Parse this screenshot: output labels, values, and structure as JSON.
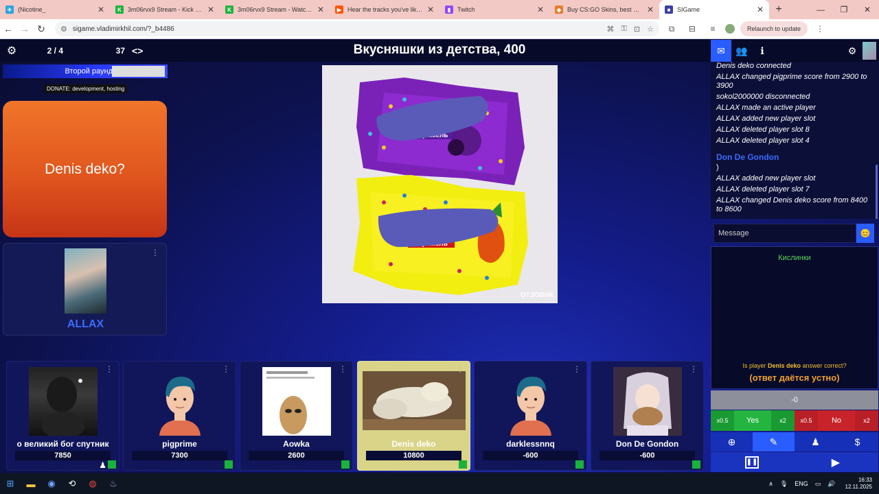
{
  "browser": {
    "tabs": [
      {
        "title": "(Nicotine_",
        "icon_color": "#2aa3e0",
        "icon_glyph": "✈"
      },
      {
        "title": "3m06rvx9 Stream - Kick Dashbo",
        "icon_color": "#1db33a",
        "icon_glyph": "K"
      },
      {
        "title": "3m06rvx9 Stream - Watch Live",
        "icon_color": "#1db33a",
        "icon_glyph": "K"
      },
      {
        "title": "Hear the tracks you've liked: on",
        "icon_color": "#ff5500",
        "icon_glyph": "▶"
      },
      {
        "title": "Twitch",
        "icon_color": "#9146ff",
        "icon_glyph": "▮"
      },
      {
        "title": "Buy CS:GO Skins, best Marketpl",
        "icon_color": "#e08030",
        "icon_glyph": "◆"
      },
      {
        "title": "SIGame",
        "icon_color": "#3d3fa8",
        "icon_glyph": "■"
      }
    ],
    "url": "sigame.vladimirkhil.com/?_b4486",
    "relaunch_label": "Relaunch to update"
  },
  "game": {
    "round_progress": "2 / 4",
    "timer": "37",
    "nav_arrows": "<>",
    "question_title": "Вкусняшки из детства, 400",
    "round_label": "Второй раунд",
    "donate_label": "DONATE: development, hosting",
    "answer_text": "Denis deko?",
    "showman_name": "ALLAX",
    "watermark": "ОТЗОВИК",
    "candy_label_1": "Карамель",
    "candy_label_2": "карамель"
  },
  "players": [
    {
      "name": "о великий бог спутник",
      "score": "7850"
    },
    {
      "name": "pigprime",
      "score": "7300"
    },
    {
      "name": "Aowka",
      "score": "2600"
    },
    {
      "name": "Denis deko",
      "score": "10800"
    },
    {
      "name": "darklessnnq",
      "score": "-600"
    },
    {
      "name": "Don De Gondon",
      "score": "-600"
    }
  ],
  "chat": {
    "messages_a": [
      "Denis deko connected",
      "ALLAX changed pigprime score from 2900 to 3900",
      "sokol2000000 disconnected",
      "ALLAX made  an active player",
      "ALLAX added new player slot",
      "ALLAX deleted player slot 8",
      "ALLAX deleted player slot 4"
    ],
    "author": "Don De Gondon",
    "author_msg": ")",
    "messages_b": [
      "ALLAX added new player slot",
      "ALLAX deleted player slot 7",
      "ALLAX changed Denis deko score from 8400 to 8600"
    ],
    "placeholder": "Message"
  },
  "judge": {
    "reference_answer": "Кислинки",
    "question_prefix": "Is player ",
    "question_player": "Denis deko",
    "question_suffix": " answer correct?",
    "note": "(ответ даётся устно)",
    "score_value": "-0",
    "yes_half": "x0.5",
    "yes_label": "Yes",
    "yes_double": "x2",
    "no_half": "x0.5",
    "no_label": "No",
    "no_double": "x2"
  },
  "taskbar": {
    "lang": "ENG",
    "time": "16:33",
    "date": "12.11.2025"
  },
  "colors": {
    "accent_blue": "#2a5dff",
    "answer_orange": "#e0561e",
    "active_player": "#d9d488",
    "yes_green": "#1db33a",
    "no_red": "#c8232a"
  }
}
